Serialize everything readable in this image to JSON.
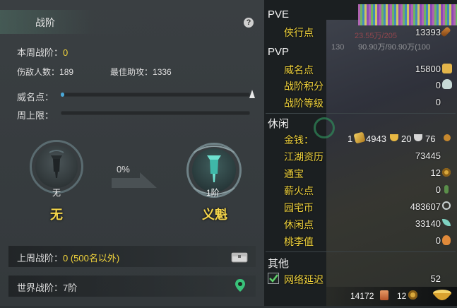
{
  "left": {
    "title": "战阶",
    "help": "?",
    "week_rank_label": "本周战阶：",
    "week_rank_value": "0",
    "kills_label": "伤敌人数：",
    "kills_value": "189",
    "assist_label": "最佳助攻：",
    "assist_value": "1336",
    "prestige_label": "威名点：",
    "prestige_progress": 0.02,
    "weekly_cap_label": "周上限：",
    "weekly_cap_progress": 0,
    "progress_percent": "0%",
    "current_rank_small": "无",
    "current_rank_name": "无",
    "next_rank_small": "1阶",
    "next_rank_name": "义魁",
    "last_week_label": "上周战阶：",
    "last_week_value": "0 (500名以外)",
    "world_rank_label": "世界战阶：",
    "world_rank_value": "7阶"
  },
  "right": {
    "pve_title": "PVE",
    "xiaxing_label": "侠行点",
    "xiaxing_value": "13393",
    "bg_text1": "23.55万/205",
    "bg_text2": "130",
    "bg_text3": "90.90万/90.90万(100",
    "pvp_title": "PVP",
    "weiming_label": "威名点",
    "weiming_value": "15800",
    "zhanjie_jifen_label": "战阶积分",
    "zhanjie_jifen_value": "0",
    "zhanjie_dengji_label": "战阶等级",
    "zhanjie_dengji_value": "0",
    "leisure_title": "休闲",
    "money_label": "金钱：",
    "money_gold_ingot": "1",
    "money_gold": "4943",
    "money_silver": "20",
    "money_copper": "76",
    "jianghu_label": "江湖资历",
    "jianghu_value": "73445",
    "tongbao_label": "通宝",
    "tongbao_value": "12",
    "xinhuo_label": "薪火点",
    "xinhuo_value": "0",
    "yuanzhai_label": "园宅币",
    "yuanzhai_value": "483607",
    "xiuxian_label": "休闲点",
    "xiuxian_value": "33140",
    "taoli_label": "桃李值",
    "taoli_value": "0",
    "other_title": "其他",
    "latency_label": "网络延迟",
    "latency_value": "52",
    "bottom_value1": "14172",
    "bottom_value2": "12",
    "colors": {
      "accent_yellow": "#f2d43c",
      "progress_blue": "#4aa8d8",
      "check_green": "#5fd06a"
    }
  }
}
